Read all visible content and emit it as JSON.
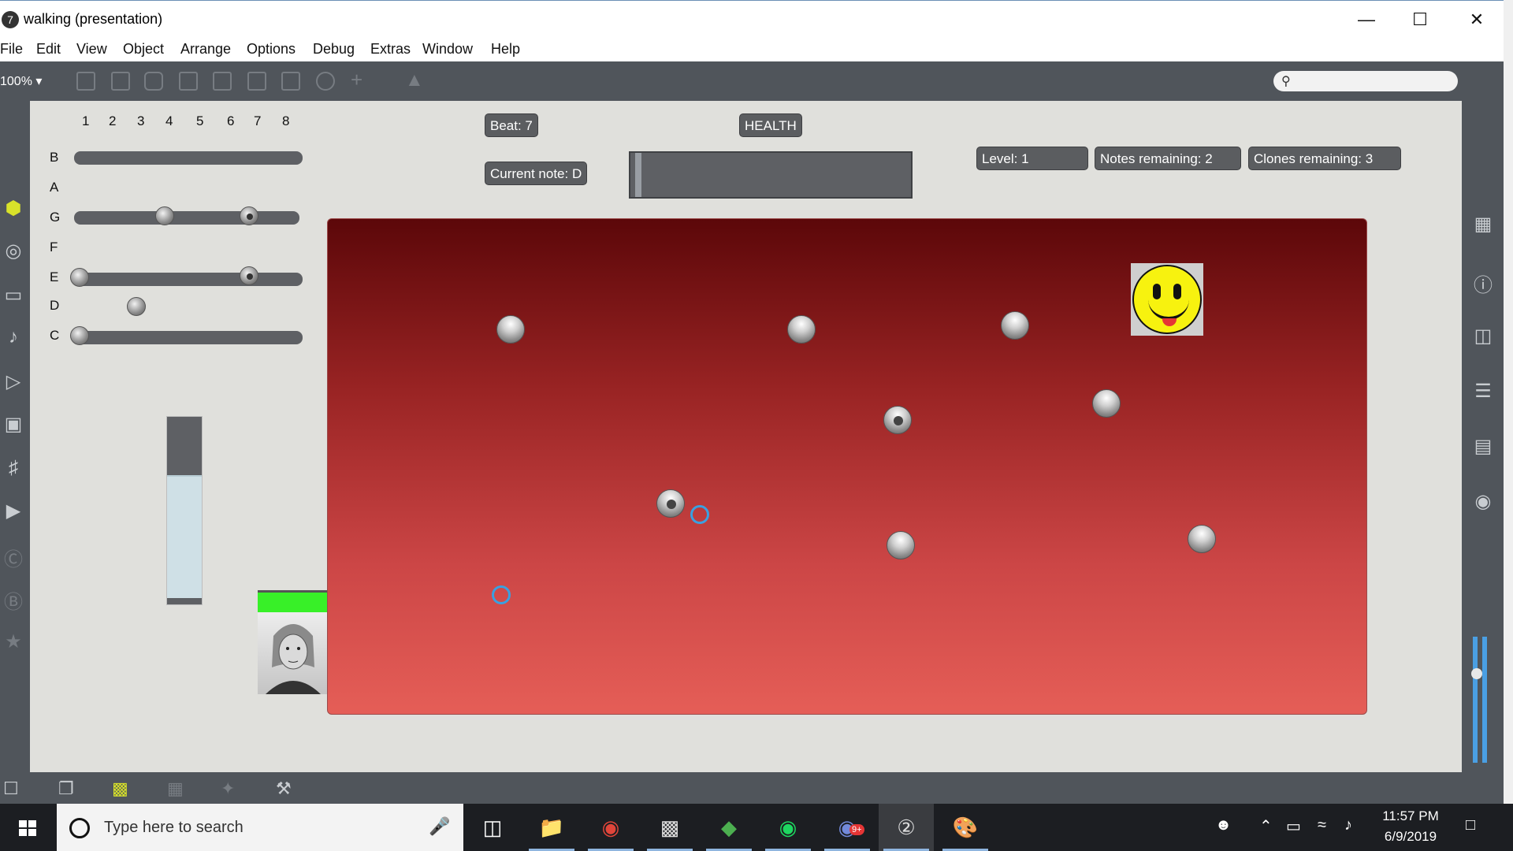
{
  "window": {
    "title": "walking (presentation)",
    "app_icon": "7"
  },
  "menu": [
    "File",
    "Edit",
    "View",
    "Object",
    "Arrange",
    "Options",
    "Debug",
    "Extras",
    "Window",
    "Help"
  ],
  "toolbar": {
    "zoom": "100%"
  },
  "piano": {
    "numbers": [
      "1",
      "2",
      "3",
      "4",
      "5",
      "6",
      "7",
      "8"
    ],
    "notes": [
      "B",
      "A",
      "G",
      "F",
      "E",
      "D",
      "C"
    ]
  },
  "hud": {
    "beat": "Beat: 7",
    "health_label": "HEALTH",
    "current_note": "Current note: D",
    "level": "Level: 1",
    "notes_remaining": "Notes remaining: 2",
    "clones_remaining": "Clones remaining: 3"
  },
  "smiley_color": "#f7f20f",
  "game_gradient": [
    "#5c0709",
    "#e55e57"
  ],
  "taskbar": {
    "search_placeholder": "Type here to search",
    "time": "11:57 PM",
    "date": "6/9/2019",
    "discord_badge": "9+"
  },
  "icons": {
    "left_sidebar": [
      "cube-icon",
      "target-icon",
      "film-icon",
      "music-note-icon",
      "skip-icon",
      "image-icon",
      "paperclip-icon",
      "plugin-icon",
      "v-icon",
      "b-icon",
      "star-icon"
    ],
    "right_sidebar": [
      "keyboard-icon",
      "info-icon",
      "columns-icon",
      "list-icon",
      "book-icon",
      "camera-icon",
      "power-icon"
    ]
  }
}
